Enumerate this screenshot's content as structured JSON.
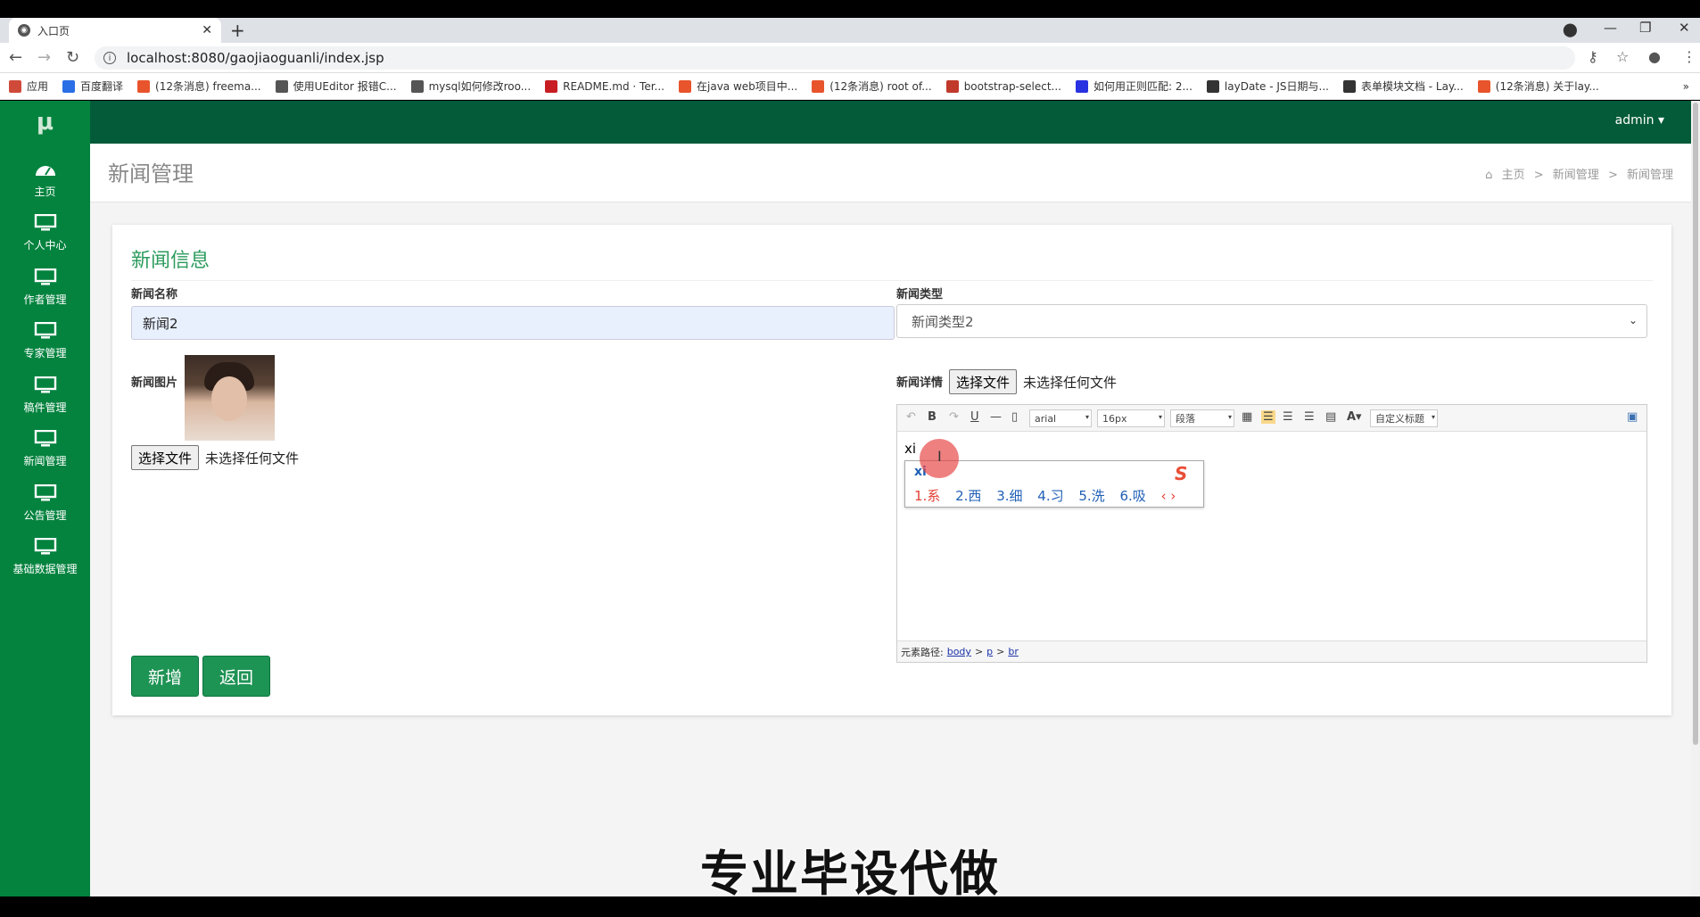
{
  "browser": {
    "tab_title": "入口页",
    "tab_close": "✕",
    "new_tab": "+",
    "url": "localhost:8080/gaojiaoguanli/index.jsp",
    "bookmarks": [
      {
        "label": "应用",
        "icon": "apps-icon",
        "color": "#d04a3a"
      },
      {
        "label": "百度翻译",
        "icon": "baidu-translate-icon",
        "color": "#2a6fe6"
      },
      {
        "label": "(12条消息) freema...",
        "icon": "csdn-icon",
        "color": "#e8542c"
      },
      {
        "label": "使用UEditor 报错C...",
        "icon": "site-icon",
        "color": "#555555"
      },
      {
        "label": "mysql如何修改roo...",
        "icon": "site-icon",
        "color": "#555555"
      },
      {
        "label": "README.md · Ter...",
        "icon": "gitee-icon",
        "color": "#c71d23"
      },
      {
        "label": "在java web项目中...",
        "icon": "csdn-icon",
        "color": "#e8542c"
      },
      {
        "label": "(12条消息) root of...",
        "icon": "csdn-icon",
        "color": "#e8542c"
      },
      {
        "label": "bootstrap-select...",
        "icon": "site-icon",
        "color": "#c0392b"
      },
      {
        "label": "如何用正则匹配: 2...",
        "icon": "baidu-icon",
        "color": "#2932e1"
      },
      {
        "label": "layDate - JS日期与...",
        "icon": "layui-icon",
        "color": "#333333"
      },
      {
        "label": "表单模块文档 - Lay...",
        "icon": "layui-icon",
        "color": "#333333"
      },
      {
        "label": "(12条消息) 关于lay...",
        "icon": "csdn-icon",
        "color": "#e8542c"
      }
    ],
    "bookmarks_more": "»"
  },
  "app": {
    "logo": "μ",
    "user": "admin ▾",
    "sidebar": [
      {
        "label": "主页",
        "icon": "dashboard-icon"
      },
      {
        "label": "个人中心",
        "icon": "monitor-icon"
      },
      {
        "label": "作者管理",
        "icon": "monitor-icon"
      },
      {
        "label": "专家管理",
        "icon": "monitor-icon"
      },
      {
        "label": "稿件管理",
        "icon": "monitor-icon"
      },
      {
        "label": "新闻管理",
        "icon": "monitor-icon"
      },
      {
        "label": "公告管理",
        "icon": "monitor-icon"
      },
      {
        "label": "基础数据管理",
        "icon": "monitor-icon"
      }
    ],
    "page_title": "新闻管理",
    "breadcrumb": [
      "主页",
      "新闻管理",
      "新闻管理"
    ],
    "breadcrumb_sep": ">",
    "form": {
      "title": "新闻信息",
      "name_label": "新闻名称",
      "name_value": "新闻2",
      "type_label": "新闻类型",
      "type_value": "新闻类型2",
      "image_label": "新闻图片",
      "file_button": "选择文件",
      "file_none": "未选择任何文件",
      "detail_label": "新闻详情",
      "editor": {
        "font": "arial",
        "size": "16px",
        "paragraph": "段落",
        "custom_title": "自定义标题",
        "text": "xi",
        "ime_pinyin": "xi",
        "ime_candidates": [
          "1.系",
          "2.西",
          "3.细",
          "4.习",
          "5.洗",
          "6.吸"
        ],
        "ime_nav": "‹ ›",
        "path_label": "元素路径:",
        "path": [
          "body",
          "p",
          "br"
        ],
        "path_sep": ">"
      },
      "add_button": "新增",
      "back_button": "返回"
    }
  },
  "overlay_caption": "专业毕设代做",
  "colors": {
    "sidebar": "#04833f",
    "topbar": "#045b39",
    "accent": "#1d9354"
  }
}
